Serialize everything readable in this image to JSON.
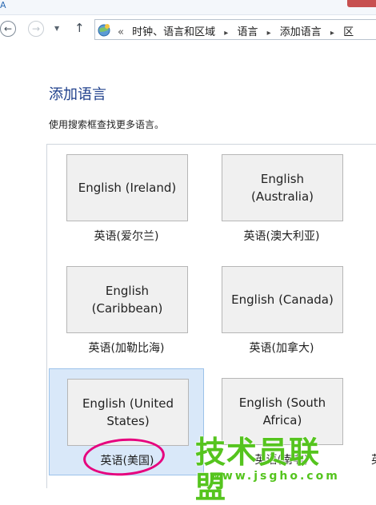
{
  "titlebar": {
    "app_glyph": "A"
  },
  "nav": {
    "back_glyph": "←",
    "forward_glyph": "→",
    "recent_glyph": "▼",
    "up_glyph": "↑"
  },
  "address": {
    "icon": "control-panel-globe-icon",
    "lead": "«",
    "crumbs": [
      "时钟、语言和区域",
      "语言",
      "添加语言",
      "区"
    ],
    "separator": "▸"
  },
  "page": {
    "title": "添加语言",
    "subtitle": "使用搜索框查找更多语言。"
  },
  "languages": [
    {
      "name": "English (Ireland)",
      "native": "英语(爱尔兰)"
    },
    {
      "name": "English (Australia)",
      "native": "英语(澳大利亚)"
    },
    {
      "name": "English (Caribbean)",
      "native": "英语(加勒比海)"
    },
    {
      "name": "English (Canada)",
      "native": "英语(加拿大)"
    },
    {
      "name": "English (United States)",
      "native": "英语(美国)",
      "selected": true
    },
    {
      "name": "English (South Africa)",
      "native": "英语(南非)"
    }
  ],
  "partial_native": "英",
  "colors": {
    "heading": "#1e3f8b",
    "selected_bg": "#d9e8f9",
    "annotation_circle": "#e6007e",
    "watermark": "#55c41e"
  },
  "watermark": {
    "main": "技术员联盟",
    "url": "www.jsgho.com"
  }
}
